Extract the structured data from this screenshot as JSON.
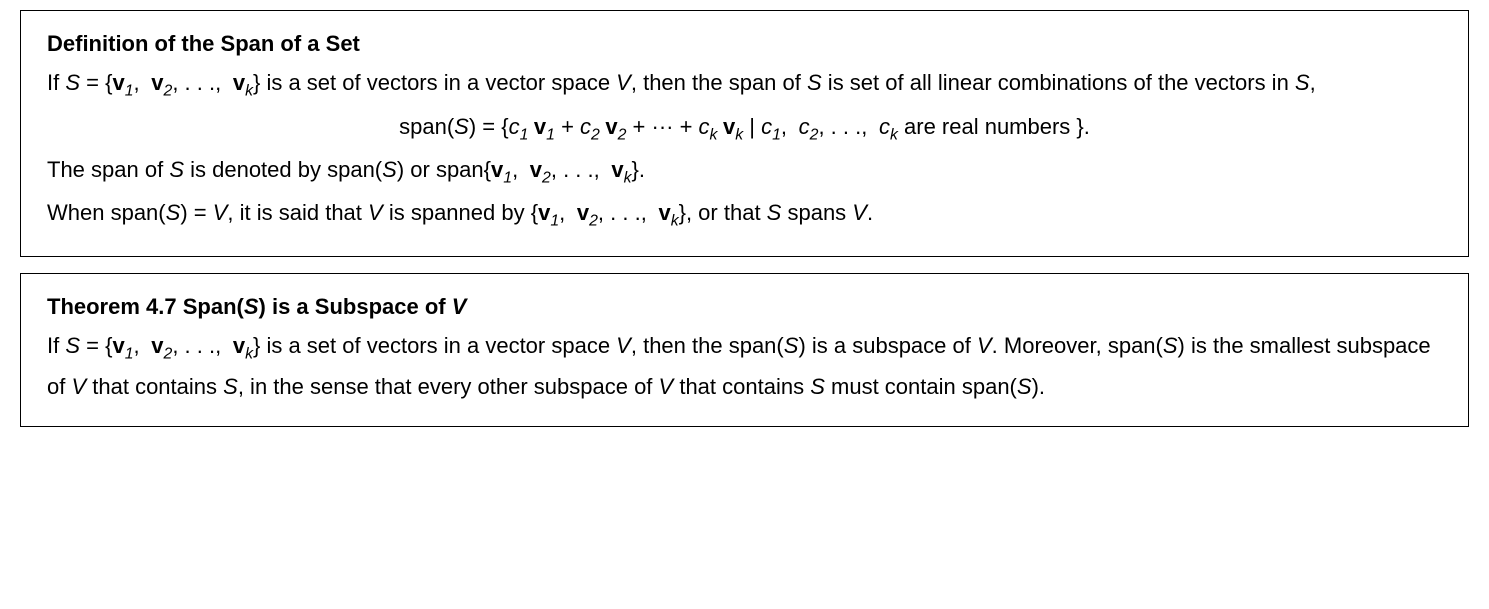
{
  "definition": {
    "title": "Definition of the Span of a Set",
    "p1_a": "If ",
    "p1_S": "S",
    "p1_eq": " = {",
    "v1": "v",
    "sub1": "1",
    "comma": ", ",
    "v2": "v",
    "sub2": "2",
    "dots": ",  . . ., ",
    "vk": "v",
    "subk": "k",
    "p1_b": "} is a set of vectors in a vector space ",
    "V": "V",
    "p1_c": ", then the span of ",
    "p1_d": " is set of all linear combinations of the vectors in ",
    "p1_e": ",",
    "eq_span": "span(",
    "eq_close": ") = {",
    "c1": "c",
    "plus": " + ",
    "cdots": " + ··· + ",
    "bar": "  |   ",
    "eq_tail": " are real numbers }.",
    "p3_a": "The span of ",
    "p3_b": " is denoted by span(",
    "p3_c": ") or span{",
    "p3_d": "}.",
    "p4_a": "When span(",
    "p4_b": ") = ",
    "p4_c": ", it is said that ",
    "p4_d": " is spanned by {",
    "p4_e": "}, or that ",
    "p4_f": " spans ",
    "p4_g": "."
  },
  "theorem": {
    "title_a": "Theorem 4.7 Span(",
    "title_S": "S",
    "title_b": ") is a Subspace of ",
    "title_V": "V",
    "p1_a": "If ",
    "p1_b": " = {",
    "p1_c": "} is a set of vectors in a vector space ",
    "p1_d": ", then the span(",
    "p1_e": ") is a subspace of ",
    "p1_f": ". Moreover, span(",
    "p1_g": ") is the smallest subspace of ",
    "p1_h": " that contains ",
    "p1_i": ", in the sense that every other subspace of ",
    "p1_j": " that contains ",
    "p1_k": " must contain span(",
    "p1_l": ")."
  }
}
